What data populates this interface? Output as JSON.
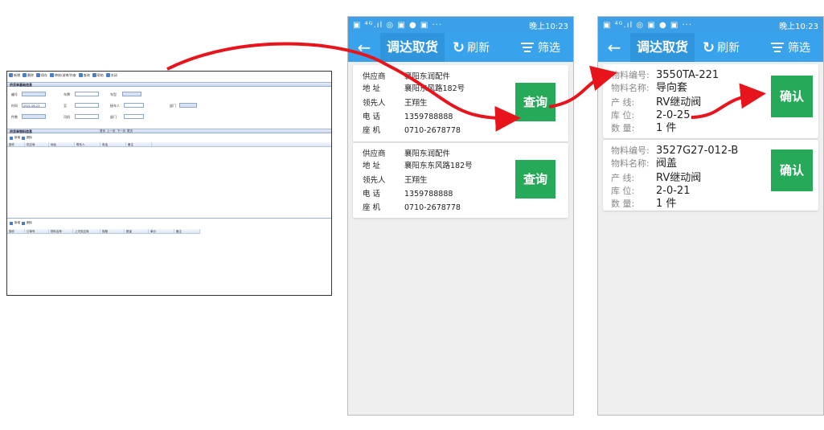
{
  "desktop": {
    "toolbar": [
      "新增",
      "删除",
      "保存",
      "审核/退审/作废",
      "查询",
      "帮助",
      "关闭"
    ],
    "section1_title": "供货单基础信息",
    "form": {
      "no_label": "编号",
      "carno_label": "车牌",
      "cartype_label": "车型",
      "time_label": "时间",
      "time_value": "2021-06-23",
      "to_label": "至",
      "receiver_label": "接车人",
      "dept_label": "部门",
      "qty_label": "件数",
      "driver_label": "司机",
      "dept2_label": "部门"
    },
    "section2_title": "供货单物料信息",
    "pager": [
      "首页",
      "上一页",
      "下一页",
      "尾页"
    ],
    "grid1_buttons": [
      "新增",
      "删除"
    ],
    "grid1_cols": [
      "操作",
      "供应商",
      "地址",
      "联系人",
      "电话",
      "备注"
    ],
    "grid2_buttons": [
      "新增",
      "删除"
    ],
    "grid2_cols": [
      "操作",
      "订单号",
      "物料名称",
      "上次供应商",
      "规格",
      "数量",
      "单价",
      "备注"
    ]
  },
  "phone1": {
    "status_time": "晚上10:23",
    "title": "调达取货",
    "refresh": "刷新",
    "filter": "筛选",
    "cards": [
      {
        "supplier_k": "供应商",
        "supplier_v": "襄阳东润配件",
        "addr_k": "地  址",
        "addr_v": "襄阳东风路182号",
        "contact_k": "领先人",
        "contact_v": "王翔生",
        "phone_k": "电  话",
        "phone_v": "1359788888",
        "tel_k": "座  机",
        "tel_v": "0710-2678778",
        "button": "查询"
      },
      {
        "supplier_k": "供应商",
        "supplier_v": "襄阳东润配件",
        "addr_k": "地  址",
        "addr_v": "襄阳东东风路182号",
        "contact_k": "领先人",
        "contact_v": "王翔生",
        "phone_k": "电  话",
        "phone_v": "1359788888",
        "tel_k": "座  机",
        "tel_v": "0710-2678778",
        "button": "查询"
      }
    ]
  },
  "phone2": {
    "status_time": "晚上10:23",
    "title": "调达取货",
    "refresh": "刷新",
    "filter": "筛选",
    "cards": [
      {
        "code_k": "物料编号:",
        "code_v": "3550TA-221",
        "name_k": "物料名称:",
        "name_v": "导向套",
        "line_k": "产  线:",
        "line_v": "RV继动阀",
        "loc_k": "库  位:",
        "loc_v": "2-0-25",
        "qty_k": "数  量:",
        "qty_v": "1 件",
        "button": "确认"
      },
      {
        "code_k": "物料编号:",
        "code_v": "3527G27-012-B",
        "name_k": "物料名称:",
        "name_v": "阀盖",
        "line_k": "产  线:",
        "line_v": "RV继动阀",
        "loc_k": "库  位:",
        "loc_v": "2-0-21",
        "qty_k": "数  量:",
        "qty_v": "1 件",
        "button": "确认"
      }
    ]
  },
  "colors": {
    "appbar": "#38a3ec",
    "button": "#27a95a",
    "arrow": "#e8141c"
  }
}
